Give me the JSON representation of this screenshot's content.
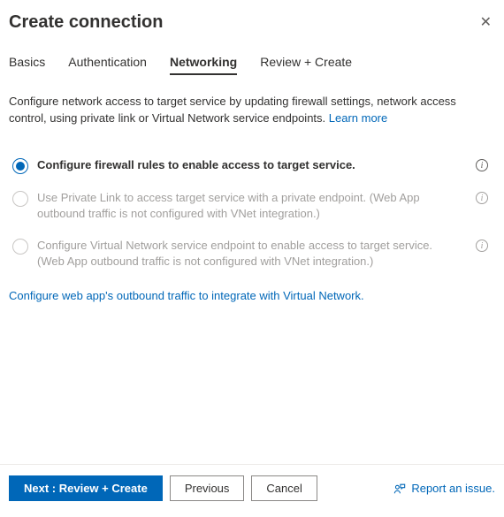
{
  "header": {
    "title": "Create connection"
  },
  "tabs": [
    {
      "label": "Basics",
      "active": false
    },
    {
      "label": "Authentication",
      "active": false
    },
    {
      "label": "Networking",
      "active": true
    },
    {
      "label": "Review + Create",
      "active": false
    }
  ],
  "description": {
    "text": "Configure network access to target service by updating firewall settings, network access control, using private link or Virtual Network service endpoints. ",
    "learn_more": "Learn more"
  },
  "options": [
    {
      "label": "Configure firewall rules to enable access to target service.",
      "selected": true,
      "disabled": false,
      "info": true
    },
    {
      "label": "Use Private Link to access target service with a private endpoint. (Web App outbound traffic is not configured with VNet integration.)",
      "selected": false,
      "disabled": true,
      "info": true
    },
    {
      "label": "Configure Virtual Network service endpoint to enable access to target service. (Web App outbound traffic is not configured with VNet integration.)",
      "selected": false,
      "disabled": true,
      "info": true
    }
  ],
  "outbound_link": "Configure web app's outbound traffic to integrate with Virtual Network.",
  "footer": {
    "next": "Next : Review + Create",
    "previous": "Previous",
    "cancel": "Cancel",
    "report": "Report an issue."
  }
}
